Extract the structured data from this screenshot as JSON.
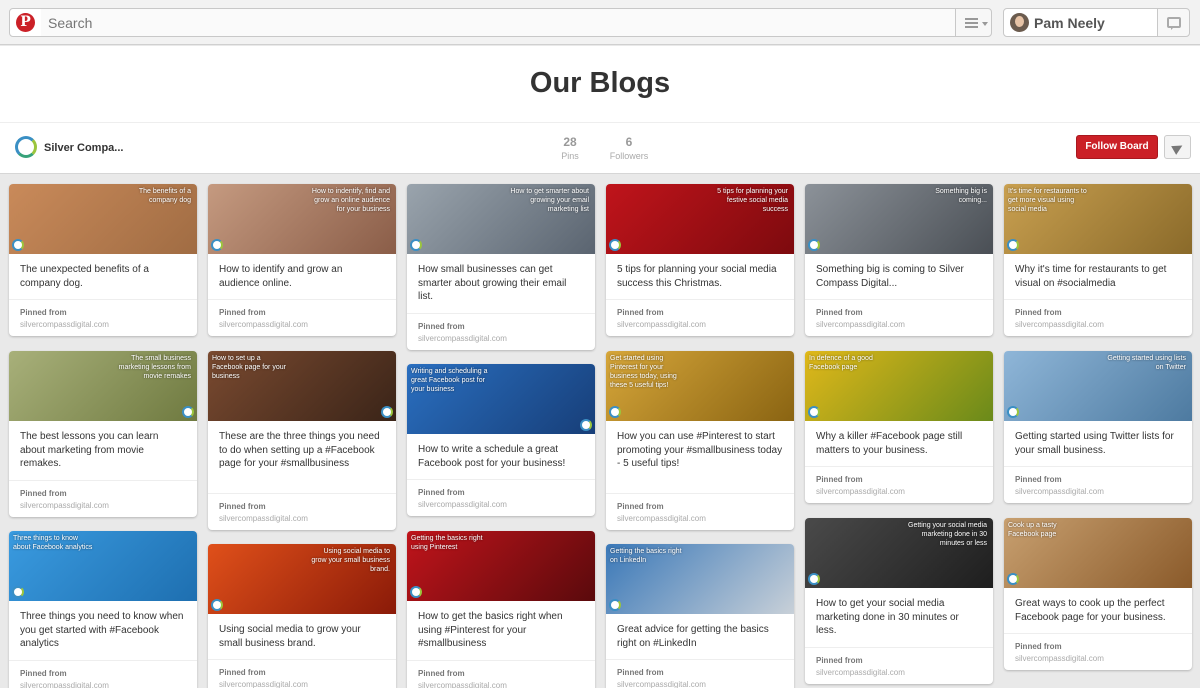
{
  "header": {
    "logo": "P",
    "search_placeholder": "Search",
    "user_name": "Pam Neely"
  },
  "board": {
    "title": "Our Blogs",
    "owner_name": "Silver Compa...",
    "stats": [
      {
        "value": "28",
        "label": "Pins"
      },
      {
        "value": "6",
        "label": "Followers"
      }
    ],
    "follow_label": "Follow Board"
  },
  "pins": [
    {
      "caption": "The benefits of a company dog",
      "description": "The unexpected benefits of a company dog.",
      "pinned_from": "Pinned from",
      "source": "silvercompassdigital.com",
      "colors": [
        "#c98a5a",
        "#a06c43"
      ]
    },
    {
      "caption": "How to indentify, find and grow an online audience for your business",
      "description": "How to identify and grow an audience online.",
      "pinned_from": "Pinned from",
      "source": "silvercompassdigital.com",
      "colors": [
        "#c59a80",
        "#8a5d48"
      ]
    },
    {
      "caption": "How to get smarter about growing your email marketing list",
      "description": "How small businesses can get smarter about growing their email list.",
      "pinned_from": "Pinned from",
      "source": "silvercompassdigital.com",
      "colors": [
        "#9aa4ad",
        "#5a6470"
      ]
    },
    {
      "caption": "5 tips for planning your festive social media success",
      "description": "5 tips for planning your social media success this Christmas.",
      "pinned_from": "Pinned from",
      "source": "silvercompassdigital.com",
      "colors": [
        "#c0141b",
        "#7d0a0e"
      ]
    },
    {
      "caption": "Something big is coming...",
      "description": "Something big is coming to Silver Compass Digital...",
      "pinned_from": "Pinned from",
      "source": "silvercompassdigital.com",
      "colors": [
        "#8c9299",
        "#4a4f55"
      ]
    },
    {
      "caption": "It's time for restaurants to get more visual using social media",
      "description": "Why it's time for restaurants to get visual on #socialmedia",
      "pinned_from": "Pinned from",
      "source": "silvercompassdigital.com",
      "colors": [
        "#c9a050",
        "#8a6a2a"
      ]
    },
    {
      "caption": "The small business marketing lessons from movie remakes",
      "description": "The best lessons you can learn about marketing from movie remakes.",
      "pinned_from": "Pinned from",
      "source": "silvercompassdigital.com",
      "colors": [
        "#a8b07a",
        "#6f7a40"
      ]
    },
    {
      "caption": "How to set up a Facebook page for your business",
      "description": "These are the three things you need to do when setting up a #Facebook page for your #smallbusiness",
      "pinned_from": "Pinned from",
      "source": "silvercompassdigital.com",
      "colors": [
        "#7a4a30",
        "#3a2418"
      ]
    },
    {
      "caption": "Writing and scheduling a great Facebook post for your business",
      "description": "How to write a schedule a great Facebook post for your business!",
      "pinned_from": "Pinned from",
      "source": "silvercompassdigital.com",
      "colors": [
        "#2a6fc0",
        "#173e78"
      ]
    },
    {
      "caption": "Get started using Pinterest for your business today, using these 5 useful tips!",
      "description": "How you can use #Pinterest to start promoting your #smallbusiness today - 5 useful tips!",
      "pinned_from": "Pinned from",
      "source": "silvercompassdigital.com",
      "colors": [
        "#d6a63a",
        "#8a6412"
      ]
    },
    {
      "caption": "In defence of a good Facebook page",
      "description": "Why a killer #Facebook page still matters to your business.",
      "pinned_from": "Pinned from",
      "source": "silvercompassdigital.com",
      "colors": [
        "#e0b81a",
        "#6a8a1a"
      ]
    },
    {
      "caption": "Getting started using lists on Twitter",
      "description": "Getting started using Twitter lists for your small business.",
      "pinned_from": "Pinned from",
      "source": "silvercompassdigital.com",
      "colors": [
        "#8fb6d8",
        "#4d7aa0"
      ]
    },
    {
      "caption": "Three things to know about Facebook analytics",
      "description": "Three things you need to know when you get started with #Facebook analytics",
      "pinned_from": "Pinned from",
      "source": "silvercompassdigital.com",
      "colors": [
        "#3a9be0",
        "#1e6fb0"
      ]
    },
    {
      "caption": "Using social media to grow your small business brand.",
      "description": "Using social media to grow your small business brand.",
      "pinned_from": "Pinned from",
      "source": "silvercompassdigital.com",
      "colors": [
        "#e0501a",
        "#8a1a08"
      ]
    },
    {
      "caption": "Getting the basics right using Pinterest",
      "description": "How to get the basics right when using #Pinterest for your #smallbusiness",
      "pinned_from": "Pinned from",
      "source": "silvercompassdigital.com",
      "colors": [
        "#c0141b",
        "#5a0a0c"
      ]
    },
    {
      "caption": "Getting the basics right on LinkedIn",
      "description": "Great advice for getting the basics right on #LinkedIn",
      "pinned_from": "Pinned from",
      "source": "silvercompassdigital.com",
      "colors": [
        "#3a78b8",
        "#c8d0d8"
      ]
    },
    {
      "caption": "Getting your social media marketing done in 30 minutes or less",
      "description": "How to get your social media marketing done in 30 minutes or less.",
      "pinned_from": "Pinned from",
      "source": "silvercompassdigital.com",
      "colors": [
        "#4a4a4a",
        "#1e1e1e"
      ]
    },
    {
      "caption": "Cook up a tasty Facebook page",
      "description": "Great ways to cook up the perfect Facebook page for your business.",
      "pinned_from": "Pinned from",
      "source": "silvercompassdigital.com",
      "colors": [
        "#c8a070",
        "#8a5a2a"
      ]
    }
  ]
}
